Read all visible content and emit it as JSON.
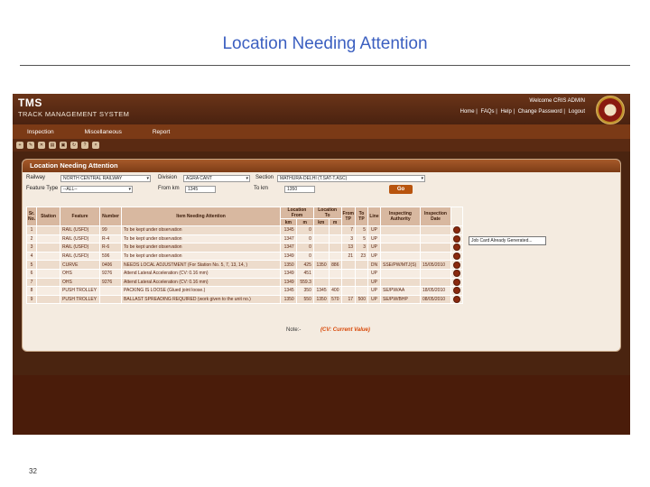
{
  "slide": {
    "title": "Location Needing Attention",
    "page_number": "32"
  },
  "app": {
    "brand": "TMS",
    "brand_sub": "TRACK MANAGEMENT SYSTEM",
    "welcome": "Welcome CRIS ADMIN",
    "links": [
      "Home",
      "FAQs",
      "Help",
      "Change Password",
      "Logout"
    ],
    "menu": [
      "Inspection",
      "Miscellaneous",
      "Report"
    ],
    "toolbar_icons": [
      "new-icon",
      "edit-icon",
      "delete-icon",
      "print-icon",
      "save-icon",
      "refresh-icon",
      "help-icon",
      "close-icon"
    ]
  },
  "panel": {
    "title": "Location Needing Attention",
    "filters": {
      "railway_label": "Railway",
      "railway_value": "NORTH CENTRAL RAILWAY",
      "division_label": "Division",
      "division_value": "AGRA CANT",
      "section_label": "Section",
      "section_value": "MATHURA-DELHI (T.SAT-T.ASC)",
      "feature_type_label": "Feature Type",
      "feature_type_value": "--ALL--",
      "from_km_label": "From km",
      "from_km_value": "1345",
      "to_km_label": "To km",
      "to_km_value": "1350",
      "go_label": "Go"
    },
    "columns": [
      "Sr. No.",
      "Station",
      "Feature",
      "Number",
      "Item Needing Attention",
      "Location From km",
      "m",
      "Location To km",
      "m",
      "From TP",
      "To TP",
      "Line",
      "Inspecting Authority",
      "Inspection Date"
    ],
    "header_groups": {
      "loc_from": "Location From",
      "loc_to": "Location To",
      "km": "km",
      "m": "m"
    },
    "rows": [
      [
        "1",
        "",
        "RAIL (USFD)",
        "99",
        "To be kept under observation",
        "1345",
        "0",
        "",
        "",
        "7",
        "5",
        "UP",
        "",
        ""
      ],
      [
        "2",
        "",
        "RAIL (USFD)",
        "R-4",
        "To be kept under observation",
        "1347",
        "0",
        "",
        "",
        "3",
        "5",
        "UP",
        "",
        ""
      ],
      [
        "3",
        "",
        "RAIL (USFD)",
        "R-6",
        "To be kept under observation",
        "1347",
        "0",
        "",
        "",
        "13",
        "3",
        "UP",
        "",
        ""
      ],
      [
        "4",
        "",
        "RAIL (USFD)",
        "596",
        "To be kept under observation",
        "1349",
        "0",
        "",
        "",
        "21",
        "23",
        "UP",
        "",
        ""
      ],
      [
        "5",
        "",
        "CURVE",
        "0406",
        "NEEDS LOCAL ADJUSTMENT (For Station No. 5, 7, 13, 14, )",
        "1350",
        "425",
        "1350",
        "886",
        "",
        "",
        "DN",
        "SSE/PW/MTJ(S)",
        "15/05/2010"
      ],
      [
        "6",
        "",
        "OHS",
        "9276",
        "Attend Lateral Acceleration (CV: 0.16 mm)",
        "1349",
        "451",
        "",
        "",
        "",
        "",
        "UP",
        "",
        ""
      ],
      [
        "7",
        "",
        "OHS",
        "9276",
        "Attend Lateral Acceleration (CV: 0.16 mm)",
        "1349",
        "559.3",
        "",
        "",
        "",
        "",
        "UP",
        "",
        ""
      ],
      [
        "8",
        "",
        "PUSH TROLLEY",
        "",
        "PACKING IS LOOSE (Glued joint loose.)",
        "1345",
        "350",
        "1345",
        "400",
        "",
        "",
        "UP",
        "SE/PW/AA",
        "18/05/2010"
      ],
      [
        "9",
        "",
        "PUSH TROLLEY",
        "",
        "BALLAST SPREADING REQUIRED (work given to the unit no.)",
        "1350",
        "550",
        "1350",
        "570",
        "17",
        "500",
        "UP",
        "SE/PW/BHP",
        "08/05/2010"
      ]
    ],
    "tooltip": "Job Card Already Generated...",
    "note_label": "Note:-",
    "note_value": "(CV: Current Value)"
  }
}
